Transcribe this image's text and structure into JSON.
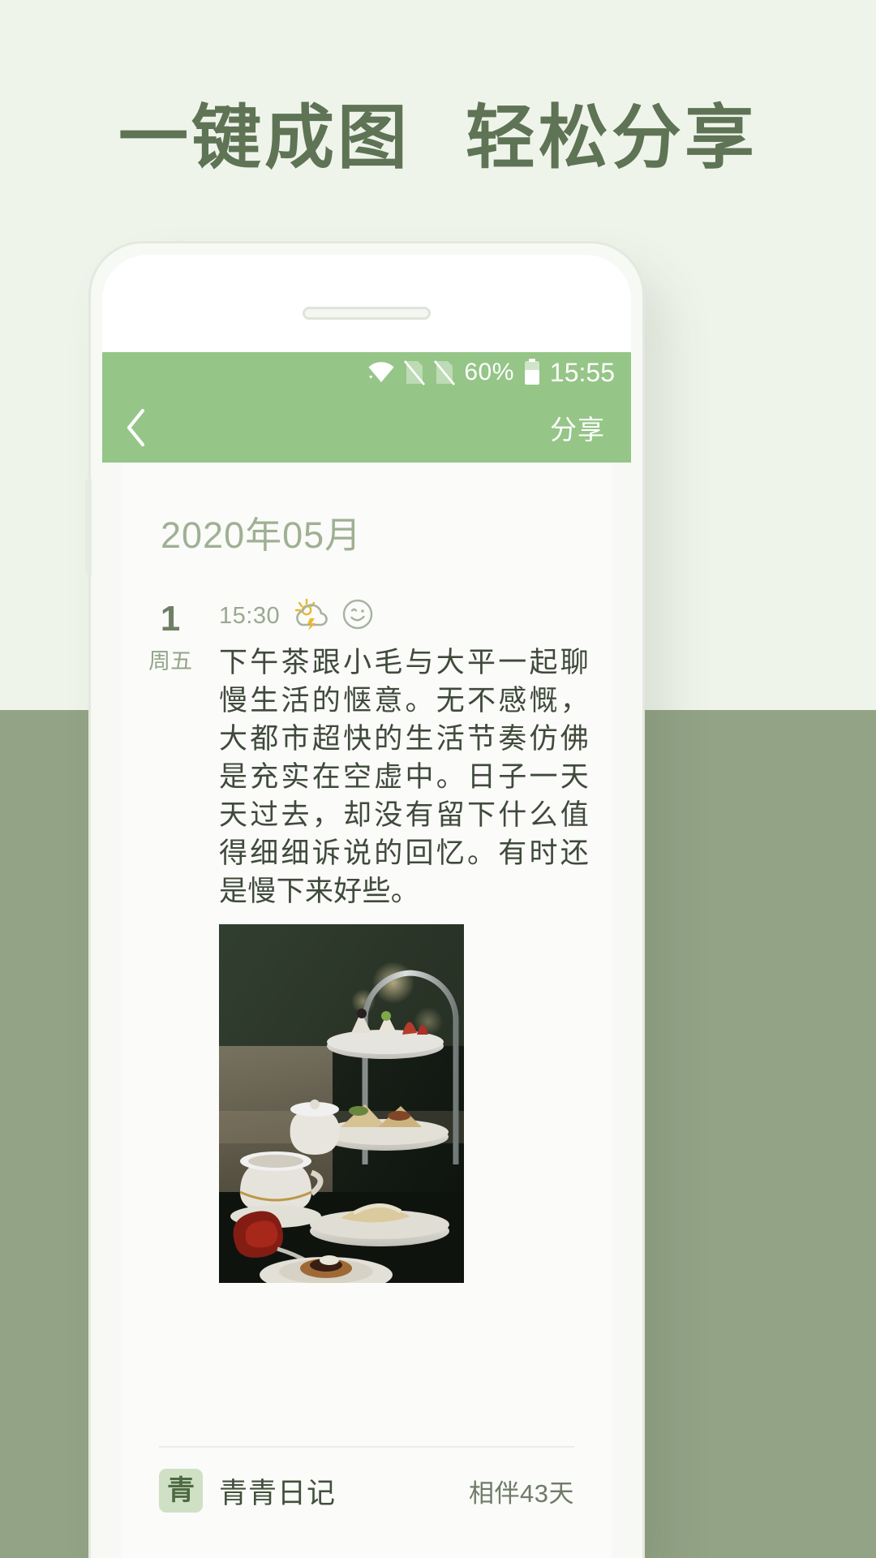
{
  "promo": {
    "headline": "一键成图  轻松分享"
  },
  "phone": {
    "statusbar": {
      "wifi_icon": "wifi-icon",
      "sim1_icon": "sim-no-signal-icon",
      "sim2_icon": "sim-no-signal-icon",
      "battery_percent": "60%",
      "battery_icon": "battery-icon",
      "time": "15:55"
    },
    "navbar": {
      "back_icon": "chevron-left-icon",
      "share_label": "分享"
    }
  },
  "card": {
    "month": "2020年05月",
    "entry": {
      "day": "1",
      "weekday": "周五",
      "time": "15:30",
      "weather_icon": "thunderstorm-cloud-sun-icon",
      "mood_icon": "smiley-face-icon",
      "text": "下午茶跟小毛与大平一起聊慢生活的惬意。无不感慨，大都市超快的生活节奏仿佛是充实在空虚中。日子一天天过去，却没有留下什么值得细细诉说的回忆。有时还是慢下来好些。",
      "photo_alt": "afternoon-tea-dessert-stand-photo"
    },
    "footer": {
      "app_icon_glyph": "青",
      "app_name": "青青日记",
      "companion_days": "相伴43天"
    }
  },
  "colors": {
    "page_bg_top": "#eff4eb",
    "page_bg_bottom": "#93a386",
    "headline": "#5f7355",
    "brand_green": "#95c587",
    "card_bg": "#fbfbf9",
    "text_primary": "#3f4a3b",
    "text_muted": "#9aa890"
  }
}
